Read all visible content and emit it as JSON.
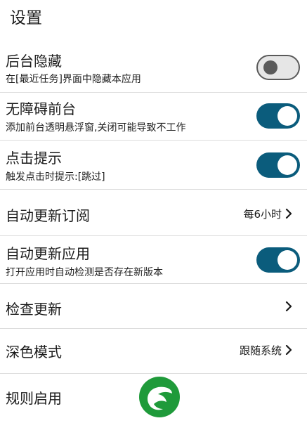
{
  "page": {
    "title": "设置"
  },
  "settings": [
    {
      "id": "hide-background",
      "title": "后台隐藏",
      "subtitle": "在[最近任务]界面中隐藏本应用",
      "kind": "toggle",
      "enabled": false
    },
    {
      "id": "accessibility-foreground",
      "title": "无障碍前台",
      "subtitle": "添加前台透明悬浮窗,关闭可能导致不工作",
      "kind": "toggle",
      "enabled": true
    },
    {
      "id": "click-hint",
      "title": "点击提示",
      "subtitle": "触发点击时提示:[跳过]",
      "kind": "toggle",
      "enabled": true
    },
    {
      "id": "auto-update-subscription",
      "title": "自动更新订阅",
      "value": "每6小时",
      "kind": "chevron"
    },
    {
      "id": "auto-update-app",
      "title": "自动更新应用",
      "subtitle": "打开应用时自动检测是否存在新版本",
      "kind": "toggle",
      "enabled": true
    },
    {
      "id": "check-update",
      "title": "检查更新",
      "kind": "chevron"
    },
    {
      "id": "dark-mode",
      "title": "深色模式",
      "value": "跟随系统",
      "kind": "chevron"
    },
    {
      "id": "rules-enable",
      "title": "规则启用",
      "kind": "plain"
    }
  ],
  "colors": {
    "toggle_on": "#0b5c7c",
    "toggle_off_bg": "#e6e6e6",
    "toggle_off_border": "#5a5a5a",
    "divider": "#dddddd",
    "logo_green": "#1f9a3a"
  },
  "icons": {
    "chevron": "chevron-right-icon",
    "logo": "leaf-logo-icon"
  }
}
